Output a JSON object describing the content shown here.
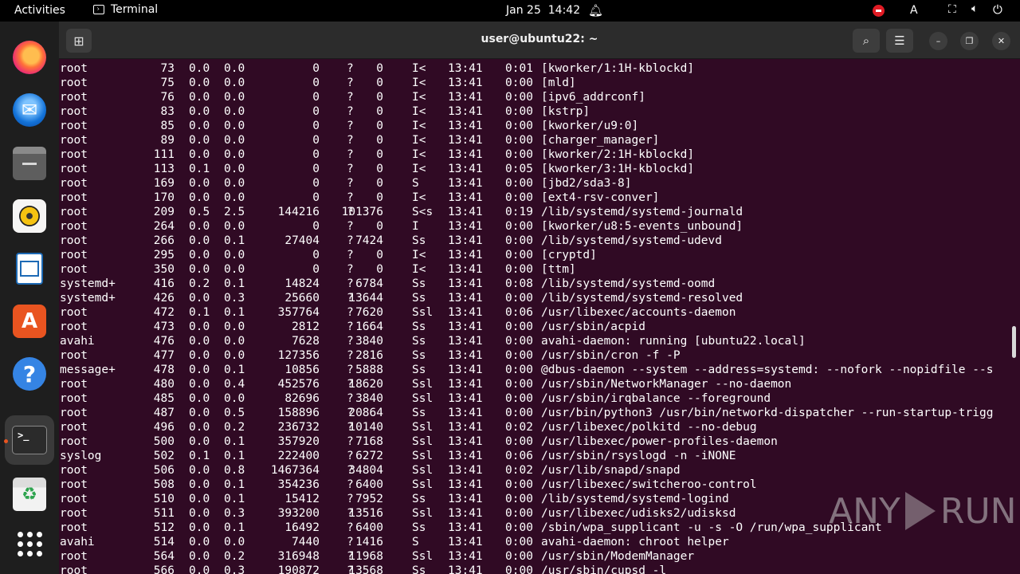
{
  "topbar": {
    "activities": "Activities",
    "app_name": "Terminal",
    "date": "Jan 25",
    "time": "14:42",
    "keyboard": "A"
  },
  "icons": {
    "bell": "bell-icon",
    "record": "screen-record-icon",
    "network": "network-icon",
    "volume": "volume-icon",
    "power": "power-icon"
  },
  "dock": {
    "items": [
      "firefox",
      "thunderbird",
      "files",
      "rhythmbox",
      "libreoffice-writer",
      "app-center",
      "help",
      "terminal",
      "trash",
      "show-apps"
    ]
  },
  "window": {
    "title": "user@ubuntu22: ~"
  },
  "colors": {
    "terminal_bg": "#300a24",
    "accent": "#e95420"
  },
  "processes": [
    {
      "user": "root",
      "pid": "73",
      "cpu": "0.0",
      "mem": "0.0",
      "vsz": "0",
      "rss": "0",
      "tty": "?",
      "stat": "I<",
      "start": "13:41",
      "time": "0:01",
      "cmd": "[kworker/1:1H-kblockd]"
    },
    {
      "user": "root",
      "pid": "75",
      "cpu": "0.0",
      "mem": "0.0",
      "vsz": "0",
      "rss": "0",
      "tty": "?",
      "stat": "I<",
      "start": "13:41",
      "time": "0:00",
      "cmd": "[mld]"
    },
    {
      "user": "root",
      "pid": "76",
      "cpu": "0.0",
      "mem": "0.0",
      "vsz": "0",
      "rss": "0",
      "tty": "?",
      "stat": "I<",
      "start": "13:41",
      "time": "0:00",
      "cmd": "[ipv6_addrconf]"
    },
    {
      "user": "root",
      "pid": "83",
      "cpu": "0.0",
      "mem": "0.0",
      "vsz": "0",
      "rss": "0",
      "tty": "?",
      "stat": "I<",
      "start": "13:41",
      "time": "0:00",
      "cmd": "[kstrp]"
    },
    {
      "user": "root",
      "pid": "85",
      "cpu": "0.0",
      "mem": "0.0",
      "vsz": "0",
      "rss": "0",
      "tty": "?",
      "stat": "I<",
      "start": "13:41",
      "time": "0:00",
      "cmd": "[kworker/u9:0]"
    },
    {
      "user": "root",
      "pid": "89",
      "cpu": "0.0",
      "mem": "0.0",
      "vsz": "0",
      "rss": "0",
      "tty": "?",
      "stat": "I<",
      "start": "13:41",
      "time": "0:00",
      "cmd": "[charger_manager]"
    },
    {
      "user": "root",
      "pid": "111",
      "cpu": "0.0",
      "mem": "0.0",
      "vsz": "0",
      "rss": "0",
      "tty": "?",
      "stat": "I<",
      "start": "13:41",
      "time": "0:00",
      "cmd": "[kworker/2:1H-kblockd]"
    },
    {
      "user": "root",
      "pid": "113",
      "cpu": "0.1",
      "mem": "0.0",
      "vsz": "0",
      "rss": "0",
      "tty": "?",
      "stat": "I<",
      "start": "13:41",
      "time": "0:05",
      "cmd": "[kworker/3:1H-kblockd]"
    },
    {
      "user": "root",
      "pid": "169",
      "cpu": "0.0",
      "mem": "0.0",
      "vsz": "0",
      "rss": "0",
      "tty": "?",
      "stat": "S",
      "start": "13:41",
      "time": "0:00",
      "cmd": "[jbd2/sda3-8]"
    },
    {
      "user": "root",
      "pid": "170",
      "cpu": "0.0",
      "mem": "0.0",
      "vsz": "0",
      "rss": "0",
      "tty": "?",
      "stat": "I<",
      "start": "13:41",
      "time": "0:00",
      "cmd": "[ext4-rsv-conver]"
    },
    {
      "user": "root",
      "pid": "209",
      "cpu": "0.5",
      "mem": "2.5",
      "vsz": "144216",
      "rss": "101376",
      "tty": "?",
      "stat": "S<s",
      "start": "13:41",
      "time": "0:19",
      "cmd": "/lib/systemd/systemd-journald"
    },
    {
      "user": "root",
      "pid": "264",
      "cpu": "0.0",
      "mem": "0.0",
      "vsz": "0",
      "rss": "0",
      "tty": "?",
      "stat": "I",
      "start": "13:41",
      "time": "0:00",
      "cmd": "[kworker/u8:5-events_unbound]"
    },
    {
      "user": "root",
      "pid": "266",
      "cpu": "0.0",
      "mem": "0.1",
      "vsz": "27404",
      "rss": "7424",
      "tty": "?",
      "stat": "Ss",
      "start": "13:41",
      "time": "0:00",
      "cmd": "/lib/systemd/systemd-udevd"
    },
    {
      "user": "root",
      "pid": "295",
      "cpu": "0.0",
      "mem": "0.0",
      "vsz": "0",
      "rss": "0",
      "tty": "?",
      "stat": "I<",
      "start": "13:41",
      "time": "0:00",
      "cmd": "[cryptd]"
    },
    {
      "user": "root",
      "pid": "350",
      "cpu": "0.0",
      "mem": "0.0",
      "vsz": "0",
      "rss": "0",
      "tty": "?",
      "stat": "I<",
      "start": "13:41",
      "time": "0:00",
      "cmd": "[ttm]"
    },
    {
      "user": "systemd+",
      "pid": "416",
      "cpu": "0.2",
      "mem": "0.1",
      "vsz": "14824",
      "rss": "6784",
      "tty": "?",
      "stat": "Ss",
      "start": "13:41",
      "time": "0:08",
      "cmd": "/lib/systemd/systemd-oomd"
    },
    {
      "user": "systemd+",
      "pid": "426",
      "cpu": "0.0",
      "mem": "0.3",
      "vsz": "25660",
      "rss": "13644",
      "tty": "?",
      "stat": "Ss",
      "start": "13:41",
      "time": "0:00",
      "cmd": "/lib/systemd/systemd-resolved"
    },
    {
      "user": "root",
      "pid": "472",
      "cpu": "0.1",
      "mem": "0.1",
      "vsz": "357764",
      "rss": "7620",
      "tty": "?",
      "stat": "Ssl",
      "start": "13:41",
      "time": "0:06",
      "cmd": "/usr/libexec/accounts-daemon"
    },
    {
      "user": "root",
      "pid": "473",
      "cpu": "0.0",
      "mem": "0.0",
      "vsz": "2812",
      "rss": "1664",
      "tty": "?",
      "stat": "Ss",
      "start": "13:41",
      "time": "0:00",
      "cmd": "/usr/sbin/acpid"
    },
    {
      "user": "avahi",
      "pid": "476",
      "cpu": "0.0",
      "mem": "0.0",
      "vsz": "7628",
      "rss": "3840",
      "tty": "?",
      "stat": "Ss",
      "start": "13:41",
      "time": "0:00",
      "cmd": "avahi-daemon: running [ubuntu22.local]"
    },
    {
      "user": "root",
      "pid": "477",
      "cpu": "0.0",
      "mem": "0.0",
      "vsz": "127356",
      "rss": "2816",
      "tty": "?",
      "stat": "Ss",
      "start": "13:41",
      "time": "0:00",
      "cmd": "/usr/sbin/cron -f -P"
    },
    {
      "user": "message+",
      "pid": "478",
      "cpu": "0.0",
      "mem": "0.1",
      "vsz": "10856",
      "rss": "5888",
      "tty": "?",
      "stat": "Ss",
      "start": "13:41",
      "time": "0:00",
      "cmd": "@dbus-daemon --system --address=systemd: --nofork --nopidfile --s"
    },
    {
      "user": "root",
      "pid": "480",
      "cpu": "0.0",
      "mem": "0.4",
      "vsz": "452576",
      "rss": "18620",
      "tty": "?",
      "stat": "Ssl",
      "start": "13:41",
      "time": "0:00",
      "cmd": "/usr/sbin/NetworkManager --no-daemon"
    },
    {
      "user": "root",
      "pid": "485",
      "cpu": "0.0",
      "mem": "0.0",
      "vsz": "82696",
      "rss": "3840",
      "tty": "?",
      "stat": "Ssl",
      "start": "13:41",
      "time": "0:00",
      "cmd": "/usr/sbin/irqbalance --foreground"
    },
    {
      "user": "root",
      "pid": "487",
      "cpu": "0.0",
      "mem": "0.5",
      "vsz": "158896",
      "rss": "20864",
      "tty": "?",
      "stat": "Ss",
      "start": "13:41",
      "time": "0:00",
      "cmd": "/usr/bin/python3 /usr/bin/networkd-dispatcher --run-startup-trigg"
    },
    {
      "user": "root",
      "pid": "496",
      "cpu": "0.0",
      "mem": "0.2",
      "vsz": "236732",
      "rss": "10140",
      "tty": "?",
      "stat": "Ssl",
      "start": "13:41",
      "time": "0:02",
      "cmd": "/usr/libexec/polkitd --no-debug"
    },
    {
      "user": "root",
      "pid": "500",
      "cpu": "0.0",
      "mem": "0.1",
      "vsz": "357920",
      "rss": "7168",
      "tty": "?",
      "stat": "Ssl",
      "start": "13:41",
      "time": "0:00",
      "cmd": "/usr/libexec/power-profiles-daemon"
    },
    {
      "user": "syslog",
      "pid": "502",
      "cpu": "0.1",
      "mem": "0.1",
      "vsz": "222400",
      "rss": "6272",
      "tty": "?",
      "stat": "Ssl",
      "start": "13:41",
      "time": "0:06",
      "cmd": "/usr/sbin/rsyslogd -n -iNONE"
    },
    {
      "user": "root",
      "pid": "506",
      "cpu": "0.0",
      "mem": "0.8",
      "vsz": "1467364",
      "rss": "34804",
      "tty": "?",
      "stat": "Ssl",
      "start": "13:41",
      "time": "0:02",
      "cmd": "/usr/lib/snapd/snapd"
    },
    {
      "user": "root",
      "pid": "508",
      "cpu": "0.0",
      "mem": "0.1",
      "vsz": "354236",
      "rss": "6400",
      "tty": "?",
      "stat": "Ssl",
      "start": "13:41",
      "time": "0:00",
      "cmd": "/usr/libexec/switcheroo-control"
    },
    {
      "user": "root",
      "pid": "510",
      "cpu": "0.0",
      "mem": "0.1",
      "vsz": "15412",
      "rss": "7952",
      "tty": "?",
      "stat": "Ss",
      "start": "13:41",
      "time": "0:00",
      "cmd": "/lib/systemd/systemd-logind"
    },
    {
      "user": "root",
      "pid": "511",
      "cpu": "0.0",
      "mem": "0.3",
      "vsz": "393200",
      "rss": "13516",
      "tty": "?",
      "stat": "Ssl",
      "start": "13:41",
      "time": "0:00",
      "cmd": "/usr/libexec/udisks2/udisksd"
    },
    {
      "user": "root",
      "pid": "512",
      "cpu": "0.0",
      "mem": "0.1",
      "vsz": "16492",
      "rss": "6400",
      "tty": "?",
      "stat": "Ss",
      "start": "13:41",
      "time": "0:00",
      "cmd": "/sbin/wpa_supplicant -u -s -O /run/wpa_supplicant"
    },
    {
      "user": "avahi",
      "pid": "514",
      "cpu": "0.0",
      "mem": "0.0",
      "vsz": "7440",
      "rss": "1416",
      "tty": "?",
      "stat": "S",
      "start": "13:41",
      "time": "0:00",
      "cmd": "avahi-daemon: chroot helper"
    },
    {
      "user": "root",
      "pid": "564",
      "cpu": "0.0",
      "mem": "0.2",
      "vsz": "316948",
      "rss": "11968",
      "tty": "?",
      "stat": "Ssl",
      "start": "13:41",
      "time": "0:00",
      "cmd": "/usr/sbin/ModemManager"
    },
    {
      "user": "root",
      "pid": "566",
      "cpu": "0.0",
      "mem": "0.3",
      "vsz": "190872",
      "rss": "13568",
      "tty": "?",
      "stat": "Ss",
      "start": "13:41",
      "time": "0:00",
      "cmd": "/usr/sbin/cupsd -l"
    }
  ],
  "watermark": {
    "left": "ANY",
    "right": "RUN"
  }
}
